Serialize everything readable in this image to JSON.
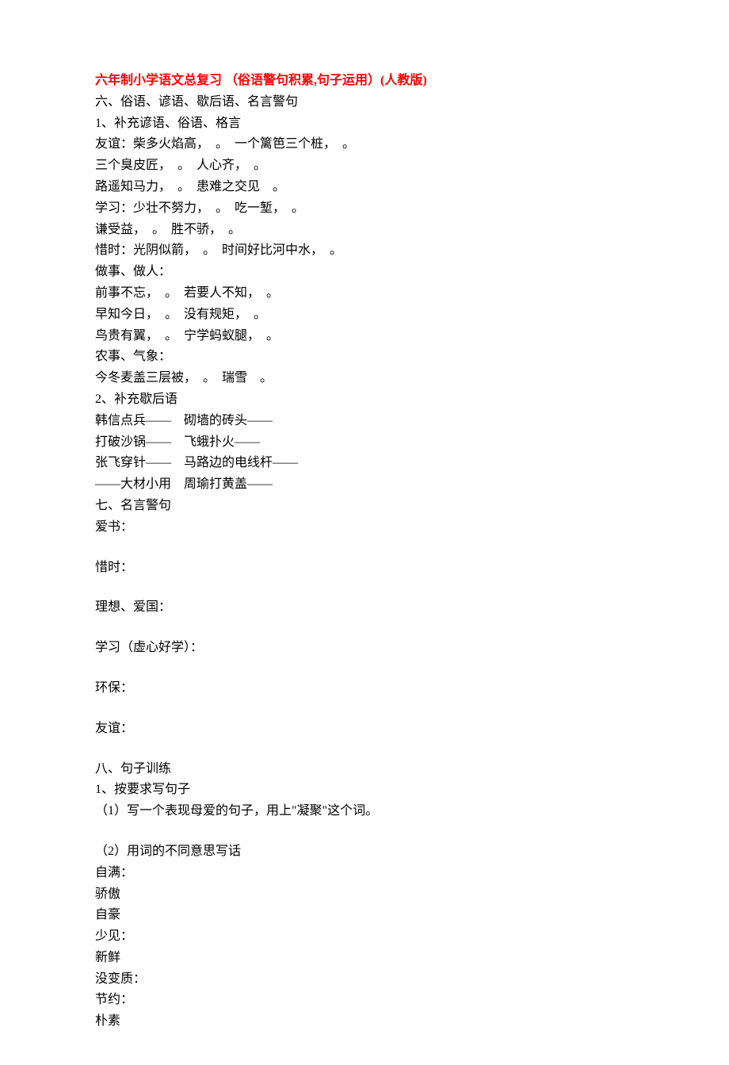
{
  "title": "六年制小学语文总复习 （俗语警句积累,句子运用）(人教版)",
  "lines": [
    "六、俗语、谚语、歇后语、名言警句",
    "1、补充谚语、俗语、格言",
    "友谊：柴多火焰高，　。　一个篱笆三个桩，　。",
    "三个臭皮匠，　。　人心齐，　。",
    "路遥知马力，　。　患难之交见　。",
    "学习：少壮不努力，　。　吃一堑，　。",
    "谦受益，　。　胜不骄，　。",
    "惜时：光阴似箭，　。　时间好比河中水，　。",
    "做事、做人：",
    "前事不忘，　。　若要人不知，　。",
    "早知今日，　。　没有规矩，　。",
    "鸟贵有翼，　。　宁学蚂蚁腿，　。",
    "农事、气象：",
    "今冬麦盖三层被，　。　瑞雪　。",
    "2、补充歇后语",
    "韩信点兵——　砌墙的砖头——",
    "打破沙锅——　飞蛾扑火——",
    "张飞穿针——　马路边的电线杆——",
    "——大材小用　周瑜打黄盖——",
    "七、名言警句",
    "爱书：",
    "",
    "惜时：",
    "",
    "理想、爱国：",
    "",
    "学习（虚心好学）：",
    "",
    "环保：",
    "",
    "友谊：",
    "",
    "八、句子训练",
    "1、按要求写句子",
    "（1）写一个表现母爱的句子，用上\"凝聚\"这个词。",
    "",
    "（2）用词的不同意思写话",
    "自满：",
    "骄傲",
    "自豪",
    "少见：",
    "新鲜",
    "没变质：",
    "节约：",
    "朴素"
  ]
}
